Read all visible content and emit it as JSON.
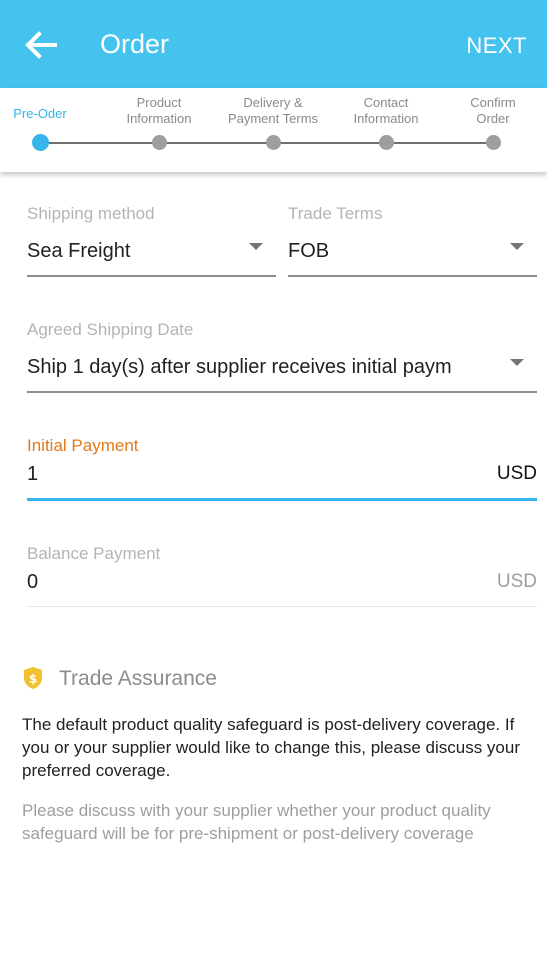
{
  "header": {
    "title": "Order",
    "next_label": "NEXT"
  },
  "steps": [
    {
      "label_line1": "Pre-Oder",
      "label_line2": "",
      "active": true
    },
    {
      "label_line1": "Product",
      "label_line2": "Information",
      "active": false
    },
    {
      "label_line1": "Delivery &",
      "label_line2": "Payment Terms",
      "active": false
    },
    {
      "label_line1": "Contact",
      "label_line2": "Information",
      "active": false
    },
    {
      "label_line1": "Confirm",
      "label_line2": "Order",
      "active": false
    }
  ],
  "shipping_method": {
    "label": "Shipping method",
    "value": "Sea Freight"
  },
  "trade_terms": {
    "label": "Trade Terms",
    "value": "FOB"
  },
  "shipping_date": {
    "label": "Agreed Shipping Date",
    "value": "Ship 1 day(s) after supplier receives initial paym"
  },
  "initial_payment": {
    "label": "Initial Payment",
    "value": "1",
    "currency": "USD"
  },
  "balance_payment": {
    "label": "Balance Payment",
    "value": "0",
    "currency": "USD"
  },
  "trade_assurance": {
    "title": "Trade Assurance",
    "icon": "shield-dollar-icon",
    "description": "The default product quality safeguard is post-delivery coverage. If you or your supplier would like to change this, please discuss your preferred coverage.",
    "hint": "Please discuss with your supplier whether your product quality safeguard will be for pre-shipment or post-delivery coverage"
  },
  "colors": {
    "app_bar": "#45c3ef",
    "accent": "#35b5ea",
    "focused_label": "#e07a16",
    "shield": "#f2c12e"
  }
}
